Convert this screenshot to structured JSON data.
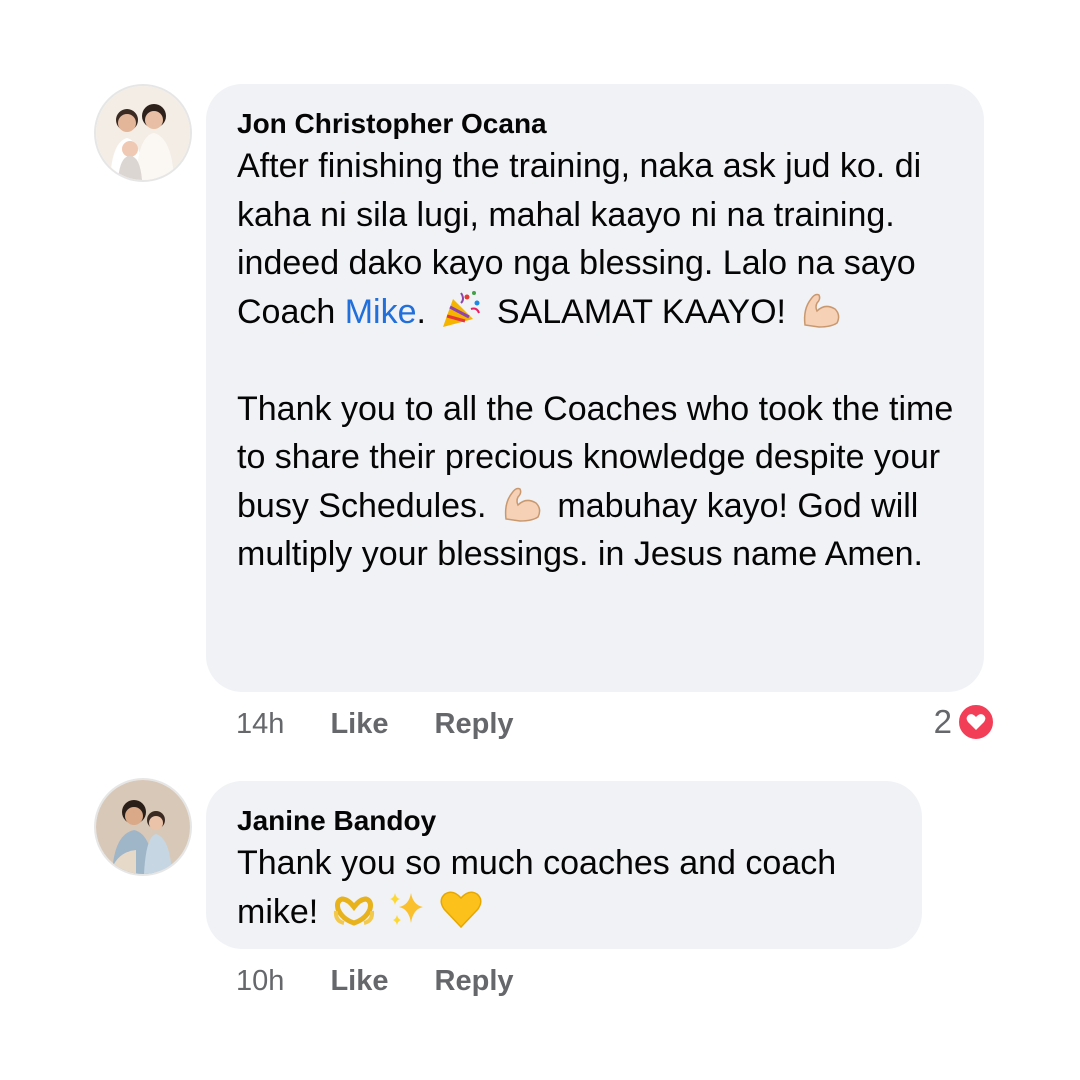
{
  "comments": [
    {
      "author": "Jon Christopher Ocana",
      "body_1": "After finishing the training, naka ask jud ko. di kaha ni sila lugi, mahal kaayo ni na training. indeed dako kayo nga blessing. Lalo na sayo Coach ",
      "mention": "Mike",
      "body_2": ".",
      "body_3": " SALAMAT KAAYO!",
      "body_4": "Thank you to all the Coaches who took the time to share their precious knowledge despite your busy Schedules.",
      "body_5": " mabuhay kayo! God will multiply your blessings. in Jesus name Amen.",
      "time": "14h",
      "like_label": "Like",
      "reply_label": "Reply",
      "reaction_count": "2",
      "reaction_icon": "heart-icon",
      "reaction_color": "#f33e58",
      "emojis": [
        "party-popper-icon",
        "flexed-biceps-icon",
        "flexed-biceps-icon"
      ]
    },
    {
      "author": "Janine Bandoy",
      "body_1": "Thank you so much coaches and coach mike!",
      "time": "10h",
      "like_label": "Like",
      "reply_label": "Reply",
      "emojis": [
        "heart-hands-icon",
        "sparkles-icon",
        "yellow-heart-icon"
      ]
    }
  ],
  "colors": {
    "bubble_bg": "#f0f2f5",
    "mention": "#216fdb",
    "meta_text": "#65676b"
  }
}
